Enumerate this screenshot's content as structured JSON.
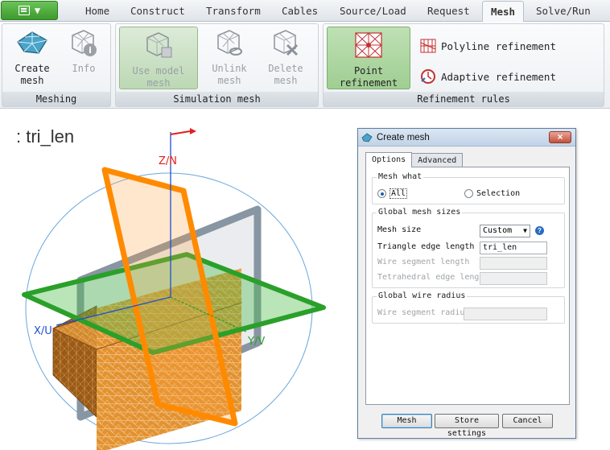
{
  "ribbon": {
    "tabs": [
      "Home",
      "Construct",
      "Transform",
      "Cables",
      "Source/Load",
      "Request",
      "Mesh",
      "Solve/Run"
    ],
    "active_tab": "Mesh",
    "groups": {
      "meshing": {
        "label": "Meshing",
        "create_mesh": "Create\nmesh",
        "info": "Info"
      },
      "simulation_mesh": {
        "label": "Simulation mesh",
        "use_model_mesh": "Use model\nmesh",
        "unlink_mesh": "Unlink\nmesh",
        "delete_mesh": "Delete\nmesh"
      },
      "refinement_rules": {
        "label": "Refinement rules",
        "point_refinement": "Point\nrefinement",
        "polyline_refinement": "Polyline refinement",
        "adaptive_refinement": "Adaptive refinement"
      }
    }
  },
  "view": {
    "caption": ": tri_len",
    "axis_z": "Z/N",
    "axis_x": "X/U",
    "axis_y": "Y/V",
    "colors": {
      "cube": "#e8952e",
      "plane_orange": "#ff8a00",
      "plane_green": "#2aa02a",
      "plane_grey": "#8895a2",
      "sphere": "#5a9bd5"
    }
  },
  "dialog": {
    "title": "Create mesh",
    "tabs": [
      "Options",
      "Advanced"
    ],
    "active_tab": "Options",
    "mesh_what": {
      "legend": "Mesh what",
      "options": [
        "All",
        "Selection"
      ],
      "selected": "All"
    },
    "global_mesh_sizes": {
      "legend": "Global mesh sizes",
      "mesh_size_label": "Mesh size",
      "mesh_size_value": "Custom",
      "triangle_edge_label": "Triangle edge length",
      "triangle_edge_value": "tri_len",
      "wire_segment_label": "Wire segment length",
      "wire_segment_value": "",
      "tetra_edge_label": "Tetrahedral edge length",
      "tetra_edge_value": ""
    },
    "global_wire_radius": {
      "legend": "Global wire radius",
      "wire_radius_label": "Wire segment radius",
      "wire_radius_value": ""
    },
    "buttons": {
      "mesh": "Mesh",
      "store_settings": "Store settings",
      "cancel": "Cancel"
    }
  }
}
